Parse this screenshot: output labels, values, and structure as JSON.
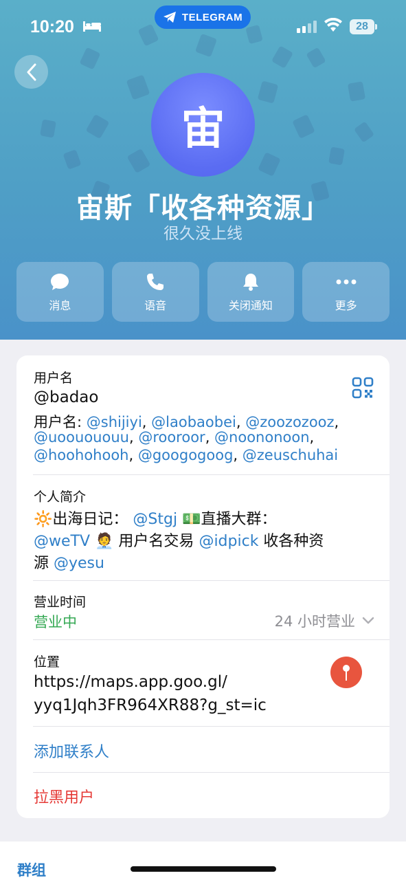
{
  "status_bar": {
    "time": "10:20",
    "app_pill": "TELEGRAM",
    "battery": "28"
  },
  "profile": {
    "avatar_char": "宙",
    "name": "宙斯「收各种资源」",
    "status": "很久没上线"
  },
  "actions": [
    {
      "label": "消息",
      "icon": "chat-bubble-icon"
    },
    {
      "label": "语音",
      "icon": "phone-icon"
    },
    {
      "label": "关闭通知",
      "icon": "bell-icon"
    },
    {
      "label": "更多",
      "icon": "more-dots-icon"
    }
  ],
  "username": {
    "label": "用户名",
    "primary": "@badao",
    "other_prefix": "用户名: ",
    "others": [
      "@shijiyi",
      "@laobaobei",
      "@zoozozooz",
      "@uoouououu",
      "@rooroor",
      "@noononoon",
      "@hoohohooh",
      "@googogoog",
      "@zeuschuhai"
    ]
  },
  "bio": {
    "label": "个人简介",
    "line1_emoji": "🔆",
    "line1_text": "出海日记：",
    "line1_link": "@Stgj",
    "line1_emoji2": "💵",
    "line1_text2": "直播大群：",
    "line2_link": "@weTV",
    "line2_emoji": "🧑‍💼",
    "line2_text": " 用户名交易 ",
    "line2_link2": "@idpick",
    "line2_text2": " 收各种资",
    "line3_text": "源 ",
    "line3_link": "@yesu"
  },
  "hours": {
    "label": "营业时间",
    "status": "营业中",
    "detail": "24 小时营业"
  },
  "location": {
    "label": "位置",
    "line1": "https://maps.app.goo.gl/",
    "line2": "yyq1Jqh3FR964XR88?g_st=ic"
  },
  "add_contact": "添加联系人",
  "block_user": "拉黑用户",
  "bottom_tab": "群组",
  "colors": {
    "header": "#4f9fc6",
    "link": "#2f7fc8",
    "open": "#34a853",
    "danger": "#e53935",
    "avatar": "#5a6cf2"
  }
}
